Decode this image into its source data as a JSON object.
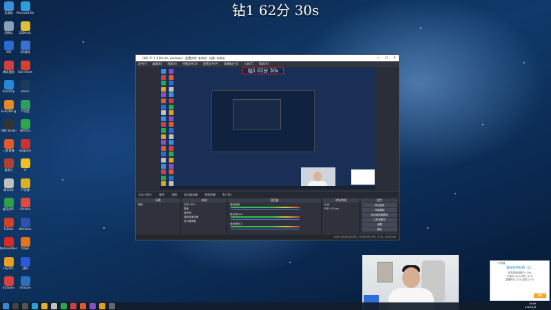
{
  "overlay": {
    "title": "钻1 62分  30s"
  },
  "desktop": {
    "icons": [
      {
        "label": "此电脑",
        "icon": "computer-icon",
        "color": "#3b8fd8"
      },
      {
        "label": "回收站",
        "icon": "recycle-bin-icon",
        "color": "#8aa0b8"
      },
      {
        "label": "360",
        "icon": "app-icon",
        "color": "#2a6bd1"
      },
      {
        "label": "腾讯视频",
        "icon": "app-icon",
        "color": "#d04040"
      },
      {
        "label": "BandiZip",
        "icon": "app-icon",
        "color": "#2a86d8"
      },
      {
        "label": "Everything",
        "icon": "search-icon",
        "color": "#e08a2a"
      },
      {
        "label": "OBS Studio",
        "icon": "obs-icon",
        "color": "#333"
      },
      {
        "label": "斗鱼直播",
        "icon": "app-icon",
        "color": "#e05a2a"
      },
      {
        "label": "爱奇艺",
        "icon": "app-icon",
        "color": "#b04030"
      },
      {
        "label": "腾讯QQ",
        "icon": "qq-icon",
        "color": "#c0c0c0"
      },
      {
        "label": "爱奇艺PC",
        "icon": "app-icon",
        "color": "#2ca04a"
      },
      {
        "label": "ToDesk",
        "icon": "app-icon",
        "color": "#d0402a"
      },
      {
        "label": "NeteaseMusic",
        "icon": "music-icon",
        "color": "#d82a2a"
      },
      {
        "label": "HuyaPC",
        "icon": "app-icon",
        "color": "#e8a020"
      },
      {
        "label": "EChome",
        "icon": "app-icon",
        "color": "#d84040"
      },
      {
        "label": "Microsoft Edge",
        "icon": "edge-icon",
        "color": "#2a9fd8"
      },
      {
        "label": "QQMusic",
        "icon": "music-icon",
        "color": "#e0c030"
      },
      {
        "label": "QQ游戏",
        "icon": "app-icon",
        "color": "#3a70d0"
      },
      {
        "label": "Riot Client",
        "icon": "app-icon",
        "color": "#d8402a"
      },
      {
        "label": "steam",
        "icon": "steam-icon",
        "color": "#1e3a5a"
      },
      {
        "label": "YY语音",
        "icon": "app-icon",
        "color": "#2aa060"
      },
      {
        "label": "WeChat",
        "icon": "wechat-icon",
        "color": "#2aa84a"
      },
      {
        "label": "wegame",
        "icon": "app-icon",
        "color": "#d03030"
      },
      {
        "label": "YY",
        "icon": "app-icon",
        "color": "#f0c020"
      },
      {
        "label": "YY直播",
        "icon": "app-icon",
        "color": "#e0b020"
      },
      {
        "label": "Chrome",
        "icon": "chrome-icon",
        "color": "#e04a3a"
      },
      {
        "label": "WeGame",
        "icon": "app-icon",
        "color": "#3050b0"
      },
      {
        "label": "Origin",
        "icon": "app-icon",
        "color": "#e8741a"
      },
      {
        "label": "战网",
        "icon": "app-icon",
        "color": "#2a5ad8"
      },
      {
        "label": "Vmware",
        "icon": "app-icon",
        "color": "#2a70c0"
      }
    ]
  },
  "obs": {
    "title": "OBS 27.1.3 (64-bit, windows) - 配置文件: 未命名 - 场景: 未命名",
    "menu": [
      "文件(F)",
      "编辑(E)",
      "视图(V)",
      "停靠部件(D)",
      "配置文件(P)",
      "场景集合(S)",
      "工具(T)",
      "帮助(H)"
    ],
    "preview_title": "钻1 62分  30s",
    "toolbar": [
      "文本 GDI+",
      "属性",
      "滤镜",
      "显示器采集",
      "视频采集",
      "44 30s"
    ],
    "docks": {
      "scenes": {
        "header": "场景",
        "items": [
          "场景"
        ]
      },
      "sources": {
        "header": "来源",
        "items": [
          "文本 GDI+",
          "图像",
          "媒体源",
          "视频采集设备",
          "显示器采集"
        ]
      },
      "mixer": {
        "header": "混音器",
        "tracks": [
          "桌面音频",
          "麦克风/Aux",
          "桌面音频 2"
        ]
      },
      "transitions": {
        "header": "转场特效",
        "items": [
          "淡出",
          "时长 300 ms"
        ]
      },
      "controls": {
        "header": "控件",
        "buttons": [
          "停止推流",
          "开始录制",
          "启动虚拟摄像机",
          "工作室模式",
          "设置",
          "退出"
        ]
      }
    },
    "status": "LIVE: 00:00:00    REC: 00:00:00    CPU: 3.2%, 30.00 fps"
  },
  "notification": {
    "app": "YY直播",
    "title": "每日签到礼物（1）",
    "lines": [
      "任务奖励领取中 (1/6)",
      "YY金币 (1/3)   积分 (1/3)",
      "直播时长 (1/3)   经验 (1/3)"
    ],
    "button": "领取"
  },
  "taskbar": {
    "items": [
      "start-icon",
      "search-icon",
      "task-view-icon",
      "edge-icon",
      "explorer-icon",
      "qq-icon",
      "wechat-icon",
      "app-icon",
      "app-icon",
      "app-icon",
      "app-icon",
      "obs-icon"
    ],
    "time": "19:59",
    "date": "2022/1/8"
  }
}
